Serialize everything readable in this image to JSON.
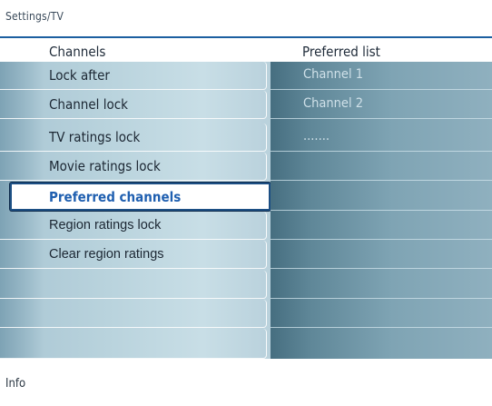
{
  "breadcrumb": "Settings/TV",
  "columns": {
    "left_title": "Channels",
    "right_title": "Preferred list"
  },
  "menu_items": [
    {
      "label": "Lock after"
    },
    {
      "label": "Channel lock"
    },
    {
      "label": "TV ratings lock"
    },
    {
      "label": "Movie ratings lock"
    },
    {
      "label": "Preferred channels",
      "selected": true
    },
    {
      "label": "Region ratings lock"
    },
    {
      "label": "Clear region ratings"
    },
    {
      "label": ""
    },
    {
      "label": ""
    },
    {
      "label": ""
    }
  ],
  "preferred_list": [
    {
      "label": "Channel 1"
    },
    {
      "label": "Channel 2"
    },
    {
      "label": "......."
    },
    {
      "label": ""
    },
    {
      "label": ""
    },
    {
      "label": ""
    },
    {
      "label": ""
    },
    {
      "label": ""
    },
    {
      "label": ""
    },
    {
      "label": ""
    }
  ],
  "footer": {
    "info_label": "Info"
  },
  "colors": {
    "accent": "#1c5fa0",
    "selected_text": "#1f5fb0"
  }
}
